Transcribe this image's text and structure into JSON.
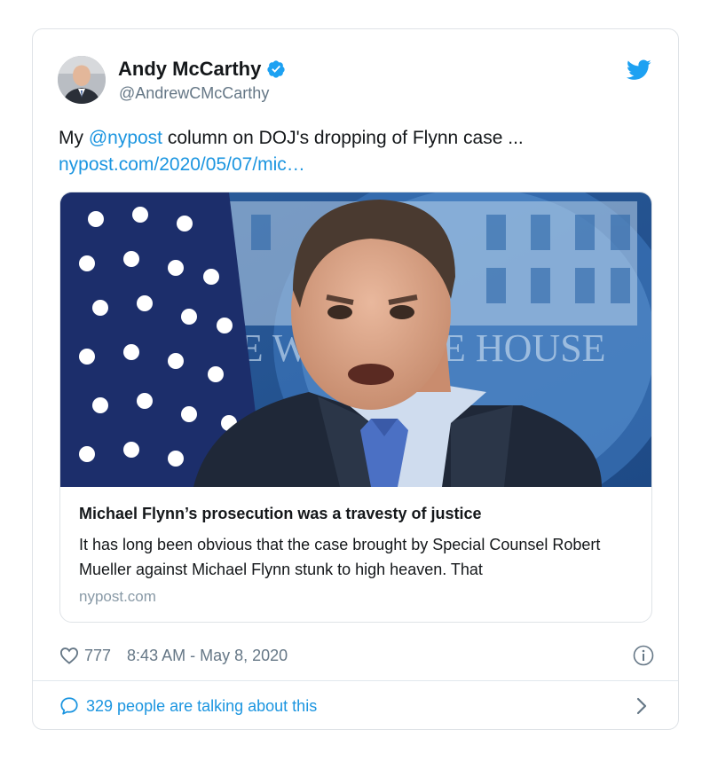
{
  "author": {
    "name": "Andy McCarthy",
    "handle": "@AndrewCMcCarthy",
    "avatar_icon": "avatar",
    "verified_icon": "verified-badge-icon"
  },
  "tweet": {
    "text_prefix": "My ",
    "mention": "@nypost",
    "text_suffix": " column on DOJ's dropping of Flynn case ...",
    "link": "nypost.com/2020/05/07/mic…"
  },
  "card": {
    "image_icon": "article-photo",
    "title": "Michael Flynn’s prosecution was a travesty of justice",
    "description": "It has long been obvious that the case brought by Special Counsel Robert Mueller against Michael Flynn stunk to high heaven. That",
    "domain": "nypost.com"
  },
  "meta": {
    "likes": "777",
    "timestamp": "8:43 AM - May 8, 2020"
  },
  "footer": {
    "talking": "329 people are talking about this"
  },
  "colors": {
    "link_blue": "#1b95e0",
    "text": "#14171a",
    "muted": "#657786",
    "border": "#dfe3e7"
  }
}
